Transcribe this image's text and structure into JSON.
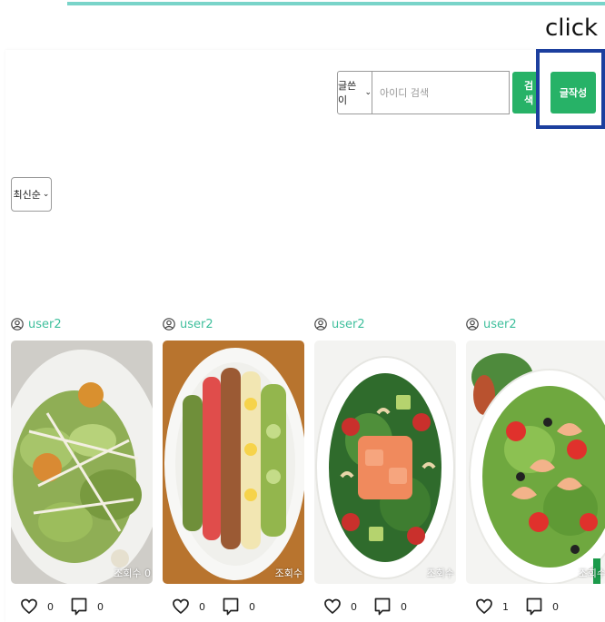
{
  "annotation": {
    "label": "click"
  },
  "search": {
    "type_selected": "글쓴이",
    "input_placeholder": "아이디 검색",
    "button_label": "검색"
  },
  "write_button": {
    "label": "글작성"
  },
  "sort": {
    "selected": "최신순"
  },
  "posts": [
    {
      "author": "user2",
      "views_label": "조회수 0",
      "likes": "0",
      "comments": "0",
      "image": "caesar-salad"
    },
    {
      "author": "user2",
      "views_label": "조회수",
      "likes": "0",
      "comments": "0",
      "image": "cobb-salad"
    },
    {
      "author": "user2",
      "views_label": "조회수",
      "likes": "0",
      "comments": "0",
      "image": "salmon-poke-salad"
    },
    {
      "author": "user2",
      "views_label": "조회수",
      "likes": "1",
      "comments": "0",
      "image": "shrimp-salad"
    }
  ],
  "colors": {
    "accent_green": "#27b267",
    "author_teal": "#3fbf9c",
    "highlight_blue": "#1c3f9e",
    "top_rule": "#79d4c9"
  }
}
